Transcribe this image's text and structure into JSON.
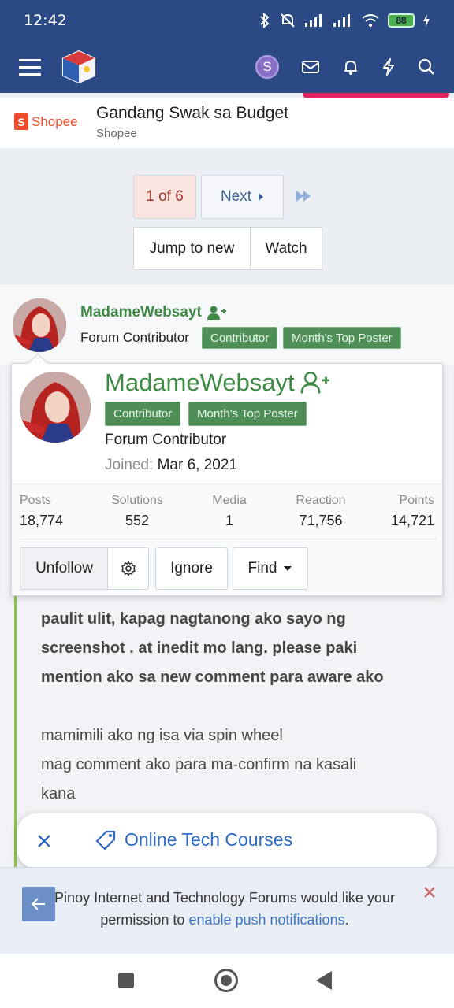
{
  "status_bar": {
    "time": "12:42",
    "battery": "88"
  },
  "header": {
    "user_initial": "S"
  },
  "ad": {
    "brand": "Shopee",
    "title": "Gandang Swak sa Budget",
    "subtitle": "Shopee"
  },
  "pagination": {
    "current": "1 of 6",
    "next_label": "Next",
    "jump_label": "Jump to new",
    "watch_label": "Watch"
  },
  "post": {
    "author": "MadameWebsayt",
    "role": "Forum Contributor",
    "badges": [
      "Contributor",
      "Month's Top Poster"
    ],
    "lines_bold": [
      "paulit ulit, kapag nagtanong ako sayo ng",
      "screenshot . at inedit mo lang. please paki",
      "mention ako sa new comment para aware ako"
    ],
    "lines_normal": [
      "mamimili ako ng isa via spin wheel",
      "mag comment ako para ma-confirm na kasali",
      "kana"
    ]
  },
  "member_tooltip": {
    "name": "MadameWebsayt",
    "badges": [
      "Contributor",
      "Month's Top Poster"
    ],
    "role": "Forum Contributor",
    "joined_label": "Joined:",
    "joined_date": "Mar 6, 2021",
    "stats": [
      {
        "label": "Posts",
        "value": "18,774"
      },
      {
        "label": "Solutions",
        "value": "552"
      },
      {
        "label": "Media",
        "value": "1"
      },
      {
        "label": "Reaction",
        "value": "71,756"
      },
      {
        "label": "Points",
        "value": "14,721"
      }
    ],
    "actions": {
      "unfollow": "Unfollow",
      "ignore": "Ignore",
      "find": "Find"
    }
  },
  "chip": {
    "label": "Online Tech Courses"
  },
  "push_banner": {
    "text_before": "Pinoy Internet and Technology Forums would like your permission to ",
    "link_text": "enable push notifications",
    "text_after": "."
  }
}
